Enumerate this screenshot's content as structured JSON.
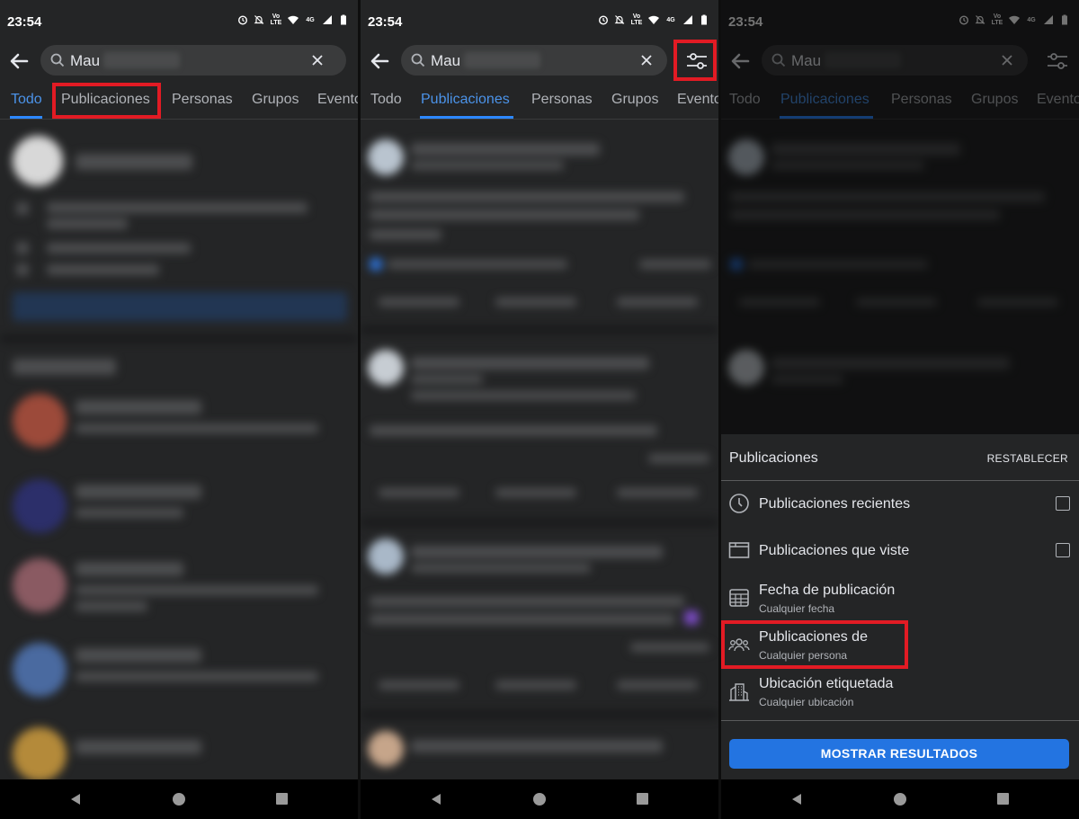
{
  "status_bar": {
    "time": "23:54",
    "network_label": "Vo LTE",
    "signal_label": "4G"
  },
  "search": {
    "query": "Mau"
  },
  "tabs": [
    "Todo",
    "Publicaciones",
    "Personas",
    "Grupos",
    "Evento"
  ],
  "filter_sheet": {
    "title": "Publicaciones",
    "reset_label": "RESTABLECER",
    "options": [
      {
        "label": "Publicaciones recientes",
        "has_checkbox": true,
        "icon": "clock-icon"
      },
      {
        "label": "Publicaciones que viste",
        "has_checkbox": true,
        "icon": "viewed-posts-icon"
      },
      {
        "label": "Fecha de publicación",
        "sublabel": "Cualquier fecha",
        "icon": "calendar-icon"
      },
      {
        "label": "Publicaciones de",
        "sublabel": "Cualquier persona",
        "icon": "people-icon"
      },
      {
        "label": "Ubicación etiquetada",
        "sublabel": "Cualquier ubicación",
        "icon": "location-building-icon"
      }
    ],
    "show_results_label": "MOSTRAR RESULTADOS"
  },
  "colors": {
    "accent": "#2d88ff",
    "highlight": "#e21b24",
    "background": "#242526",
    "button": "#2374e1"
  }
}
